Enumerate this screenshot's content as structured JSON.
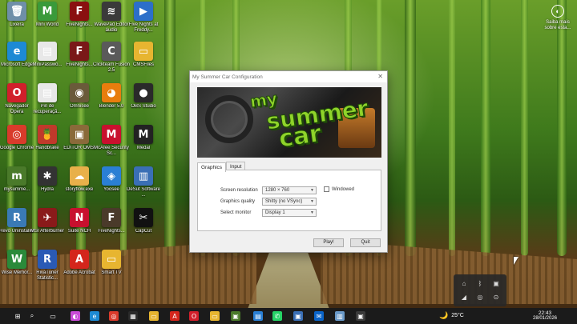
{
  "desktop": {
    "icons": [
      {
        "label": "Lixeira",
        "glyph": "🗑",
        "color": "#6f8fa8"
      },
      {
        "label": "Mini World",
        "glyph": "M",
        "color": "#3a9a3a"
      },
      {
        "label": "FiveNights...",
        "glyph": "F",
        "color": "#8a1010"
      },
      {
        "label": "WavePad Editor áudio",
        "glyph": "≋",
        "color": "#3a3a3a"
      },
      {
        "label": "Five Nights at Freddy...",
        "glyph": "▶",
        "color": "#2c6fc9"
      },
      {
        "label": "Microsoft Edge",
        "glyph": "e",
        "color": "#1d8ad4"
      },
      {
        "label": "MiniPasswo...",
        "glyph": "▤",
        "color": "#e8e8e8"
      },
      {
        "label": "FiveNights...",
        "glyph": "F",
        "color": "#7a1818"
      },
      {
        "label": "Clickteam Fusion 2.5",
        "glyph": "C",
        "color": "#5a5a5a"
      },
      {
        "label": "CMSFiles",
        "glyph": "▭",
        "color": "#e7b530"
      },
      {
        "label": "Navegador Opera",
        "glyph": "O",
        "color": "#d11f2b"
      },
      {
        "label": "Pin de recuperaçã...",
        "glyph": "▤",
        "color": "#e8e8e8"
      },
      {
        "label": "Omnisee",
        "glyph": "◉",
        "color": "#6a5a3a"
      },
      {
        "label": "Blender 5.0",
        "glyph": "◕",
        "color": "#e87d0d"
      },
      {
        "label": "OBS Studio",
        "glyph": "●",
        "color": "#2a2a2a"
      },
      {
        "label": "Google Chrome",
        "glyph": "◎",
        "color": "#d93b2b"
      },
      {
        "label": "Handbrake",
        "glyph": "🍍",
        "color": "#c0392b"
      },
      {
        "label": "EDITOR OMSI",
        "glyph": "▣",
        "color": "#8a6a3a"
      },
      {
        "label": "McAfee Security Sc...",
        "glyph": "M",
        "color": "#c8102e"
      },
      {
        "label": "Medal",
        "glyph": "M",
        "color": "#222222"
      },
      {
        "label": "mysumme...",
        "glyph": "m",
        "color": "#4a7a2a"
      },
      {
        "label": "Hydra",
        "glyph": "✱",
        "color": "#333333"
      },
      {
        "label": "storyflow.exe",
        "glyph": "☁",
        "color": "#e8b04a"
      },
      {
        "label": "Yoosee",
        "glyph": "◈",
        "color": "#2a7fd4"
      },
      {
        "label": "DeSut Software ...",
        "glyph": "▥",
        "color": "#3a6fb5"
      },
      {
        "label": "Revo Uninstaller",
        "glyph": "R",
        "color": "#3a7ab5"
      },
      {
        "label": "MSI Afterburner",
        "glyph": "✈",
        "color": "#8a1a1a"
      },
      {
        "label": "Suite NCH",
        "glyph": "N",
        "color": "#c8102e"
      },
      {
        "label": "FiveNights...",
        "glyph": "F",
        "color": "#4a3a2a"
      },
      {
        "label": "CapCut",
        "glyph": "✂",
        "color": "#111111"
      },
      {
        "label": "Wise Memor...",
        "glyph": "W",
        "color": "#2a8a3a"
      },
      {
        "label": "RivaTuner Statistic...",
        "glyph": "R",
        "color": "#2a5ab5"
      },
      {
        "label": "Adobe Acrobat",
        "glyph": "A",
        "color": "#d4261c"
      },
      {
        "label": "Smart TV",
        "glyph": "▭",
        "color": "#e7b530"
      }
    ],
    "top_right": {
      "label": "Saiba mais sobre esta...",
      "glyph": "◐"
    }
  },
  "dialog": {
    "title": "My Summer Car Configuration",
    "close_glyph": "✕",
    "banner": {
      "line1": "my",
      "line2": "summer",
      "line3": "car"
    },
    "tabs": [
      "Graphics",
      "Input"
    ],
    "fields": [
      {
        "label": "Screen resolution",
        "value": "1280 × 760"
      },
      {
        "label": "Graphics quality",
        "value": "Shitty (no VSync)"
      },
      {
        "label": "Select monitor",
        "value": "Display 1"
      }
    ],
    "windowed_label": "Windowed",
    "play_label": "Play!",
    "quit_label": "Quit"
  },
  "tray_flyout": {
    "icons": [
      {
        "name": "usb-icon",
        "glyph": "⌂"
      },
      {
        "name": "bluetooth-icon",
        "glyph": "ᛒ"
      },
      {
        "name": "app-tray-icon",
        "glyph": "▣"
      },
      {
        "name": "nvidia-icon",
        "glyph": "◢"
      },
      {
        "name": "chrome-tray-icon",
        "glyph": "◎"
      },
      {
        "name": "steam-tray-icon",
        "glyph": "⊙"
      }
    ]
  },
  "taskbar": {
    "items": [
      {
        "name": "start-button",
        "glyph": "⊞",
        "color": "#1b1b1b"
      },
      {
        "name": "search-icon",
        "glyph": "⌕",
        "color": "#1b1b1b"
      },
      {
        "name": "taskview-icon",
        "glyph": "▭",
        "color": "#1b1b1b"
      },
      {
        "name": "copilot-icon",
        "glyph": "◐",
        "color": "#c94bd6"
      },
      {
        "name": "edge-icon",
        "glyph": "e",
        "color": "#1d8ad4"
      },
      {
        "name": "chrome-icon",
        "glyph": "◎",
        "color": "#d93b2b"
      },
      {
        "name": "store-icon",
        "glyph": "▦",
        "color": "#2a2a2a"
      },
      {
        "name": "files-icon",
        "glyph": "▭",
        "color": "#e7b530"
      },
      {
        "name": "acrobat-icon",
        "glyph": "A",
        "color": "#d4261c"
      },
      {
        "name": "opera-icon",
        "glyph": "O",
        "color": "#d11f2b"
      },
      {
        "name": "folder-icon",
        "glyph": "▭",
        "color": "#e7b530"
      },
      {
        "name": "game-icon",
        "glyph": "▣",
        "color": "#4a7a2a"
      },
      {
        "name": "explorer-icon",
        "glyph": "▤",
        "color": "#2a7fd4"
      },
      {
        "name": "whatsapp-icon",
        "glyph": "✆",
        "color": "#25d366"
      },
      {
        "name": "app-icon",
        "glyph": "▣",
        "color": "#3a6fb5"
      },
      {
        "name": "outlook-icon",
        "glyph": "✉",
        "color": "#0a64c8"
      },
      {
        "name": "paint-icon",
        "glyph": "▥",
        "color": "#6a9ac9"
      },
      {
        "name": "terminal-icon",
        "glyph": "▣",
        "color": "#3a3a3a"
      }
    ],
    "weather": {
      "glyph": "🌙",
      "temp": "25°C"
    },
    "clock": {
      "time": "22:43",
      "date": "28/01/2026"
    }
  }
}
